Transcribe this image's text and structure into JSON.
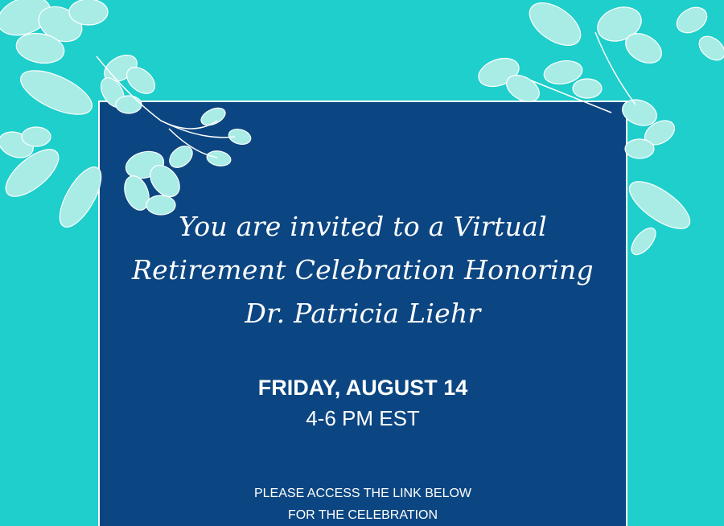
{
  "colors": {
    "background": "#1ecfcb",
    "card": "#0c4682",
    "flower": "#a8ece5",
    "text": "#ffffff"
  },
  "invitation": {
    "headline_lines": [
      "You are invited to a Virtual",
      "Retirement Celebration Honoring",
      "Dr. Patricia Liehr"
    ],
    "date": "FRIDAY, AUGUST 14",
    "time": "4-6 PM EST",
    "note_lines": [
      "PLEASE ACCESS THE LINK BELOW",
      "FOR THE CELEBRATION"
    ]
  }
}
